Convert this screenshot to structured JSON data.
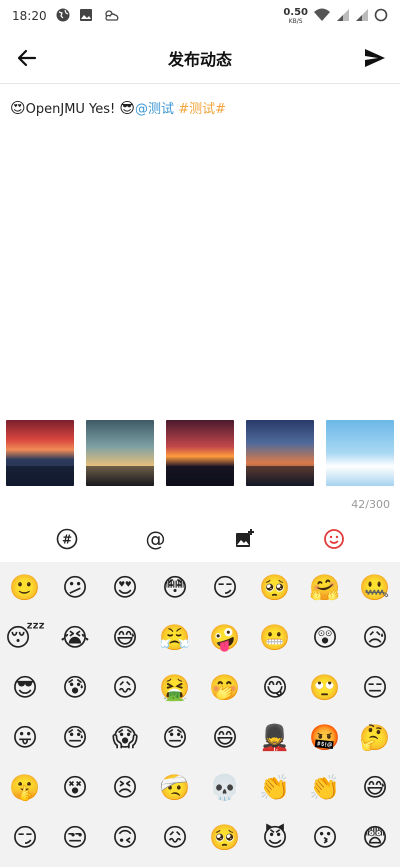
{
  "status": {
    "time": "18:20",
    "speed_value": "0.50",
    "speed_unit": "KB/S"
  },
  "app_bar": {
    "title": "发布动态"
  },
  "editor": {
    "emoji_1": "😍",
    "text_1": "OpenJMU Yes! ",
    "emoji_2": "😎",
    "mention": "@测试",
    "topic": "#测试#"
  },
  "images": {
    "counter": "42/300"
  },
  "toolbar": {
    "topic_icon": "#",
    "mention_icon": "@"
  },
  "emoji_rows": [
    [
      "🙂",
      "😕",
      "😍",
      "😳",
      "😏",
      "🥺",
      "🤗",
      "🤐"
    ],
    [
      "😴",
      "😭",
      "😅",
      "😤",
      "🤪",
      "😬",
      "😲",
      "😥"
    ],
    [
      "😎",
      "😰",
      "😖",
      "🤮",
      "🤭",
      "😋",
      "🙄",
      "😑"
    ],
    [
      "😛",
      "😓",
      "😱",
      "😓",
      "😄",
      "💂",
      "🤬",
      "🤔"
    ],
    [
      "🤫",
      "😵",
      "😣",
      "🤕",
      "💀",
      "👏",
      "👏",
      "😅"
    ],
    [
      "😏",
      "😒",
      "🙃",
      "😖",
      "🥺",
      "😈",
      "😗",
      "😨"
    ]
  ]
}
